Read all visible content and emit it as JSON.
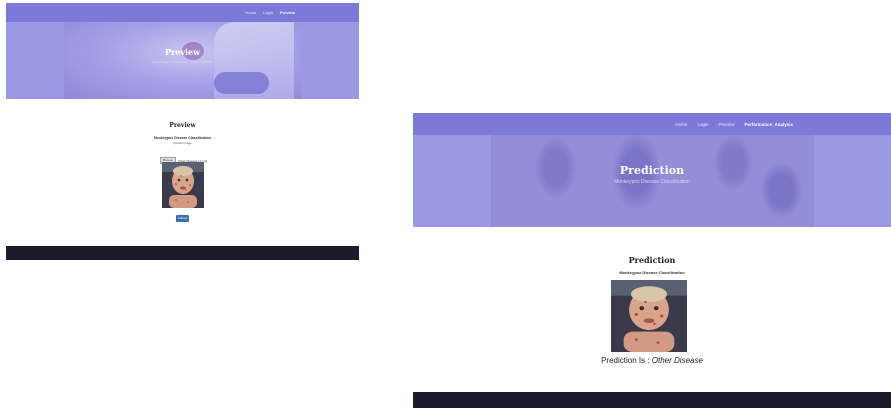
{
  "left": {
    "nav": {
      "items": [
        "Home",
        "Login",
        "Preview"
      ],
      "active": "Preview"
    },
    "banner": {
      "title": "Preview",
      "subtitle": "Monkeypox Disease Classification"
    },
    "section": {
      "title": "Preview",
      "subtitle": "Monkeypox Disease Classification",
      "upload_label": "Upload Image"
    },
    "file_input": {
      "button_label": "Browse",
      "file_name": "Other Disease 17.png"
    },
    "submit_label": "Submit"
  },
  "right": {
    "nav": {
      "items": [
        "Home",
        "Login",
        "Preview",
        "Performance_Analysis"
      ],
      "active": "Performance_Analysis"
    },
    "banner": {
      "title": "Prediction",
      "subtitle": "Monkeypox Disease Classification"
    },
    "section": {
      "title": "Prediction",
      "subtitle": "Monkeypox Disease Classification"
    },
    "result": {
      "label": "Prediction Is :",
      "value": "Other Disease"
    }
  },
  "colors": {
    "nav": "#7d79d9",
    "banner": "#9b98e6",
    "footer": "#1e1a2b",
    "button": "#3b6fb3"
  }
}
